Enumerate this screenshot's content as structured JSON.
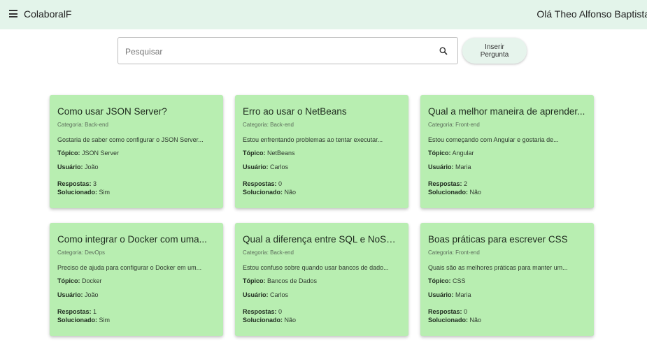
{
  "header": {
    "menu_icon": "hamburger-menu-icon",
    "title": "ColaboralF",
    "greeting": "Olá Theo Alfonso Baptista",
    "background": "#e3f4ea"
  },
  "search": {
    "placeholder": "Pesquisar",
    "value": "",
    "icon": "search-icon"
  },
  "insert_button": {
    "label": "Inserir Pergunta"
  },
  "labels": {
    "topic": "Tópico:",
    "user": "Usuário:",
    "answers": "Respostas:",
    "solved": "Solucionado:"
  },
  "card_color": "#b8eeb1",
  "cards": [
    {
      "title": "Como usar JSON Server?",
      "category": "Categoria: Back-end",
      "description": "Gostaria de saber como configurar o JSON Server...",
      "topic": "JSON Server",
      "user": "João",
      "answers": "3",
      "solved": "Sim"
    },
    {
      "title": "Erro ao usar o NetBeans",
      "category": "Categoria: Back-end",
      "description": "Estou enfrentando problemas ao tentar executar...",
      "topic": "NetBeans",
      "user": "Carlos",
      "answers": "0",
      "solved": "Não"
    },
    {
      "title": "Qual a melhor maneira de aprender...",
      "category": "Categoria: Front-end",
      "description": "Estou começando com Angular e gostaria de...",
      "topic": "Angular",
      "user": "Maria",
      "answers": "2",
      "solved": "Não"
    },
    {
      "title": "Como integrar o Docker com uma...",
      "category": "Categoria: DevOps",
      "description": "Preciso de ajuda para configurar o Docker em um...",
      "topic": "Docker",
      "user": "João",
      "answers": "1",
      "solved": "Sim"
    },
    {
      "title": "Qual a diferença entre SQL e NoSQL?",
      "category": "Categoria: Back-end",
      "description": "Estou confuso sobre quando usar bancos de dado...",
      "topic": "Bancos de Dados",
      "user": "Carlos",
      "answers": "0",
      "solved": "Não"
    },
    {
      "title": "Boas práticas para escrever CSS",
      "category": "Categoria: Front-end",
      "description": "Quais são as melhores práticas para manter um...",
      "topic": "CSS",
      "user": "Maria",
      "answers": "0",
      "solved": "Não"
    }
  ]
}
